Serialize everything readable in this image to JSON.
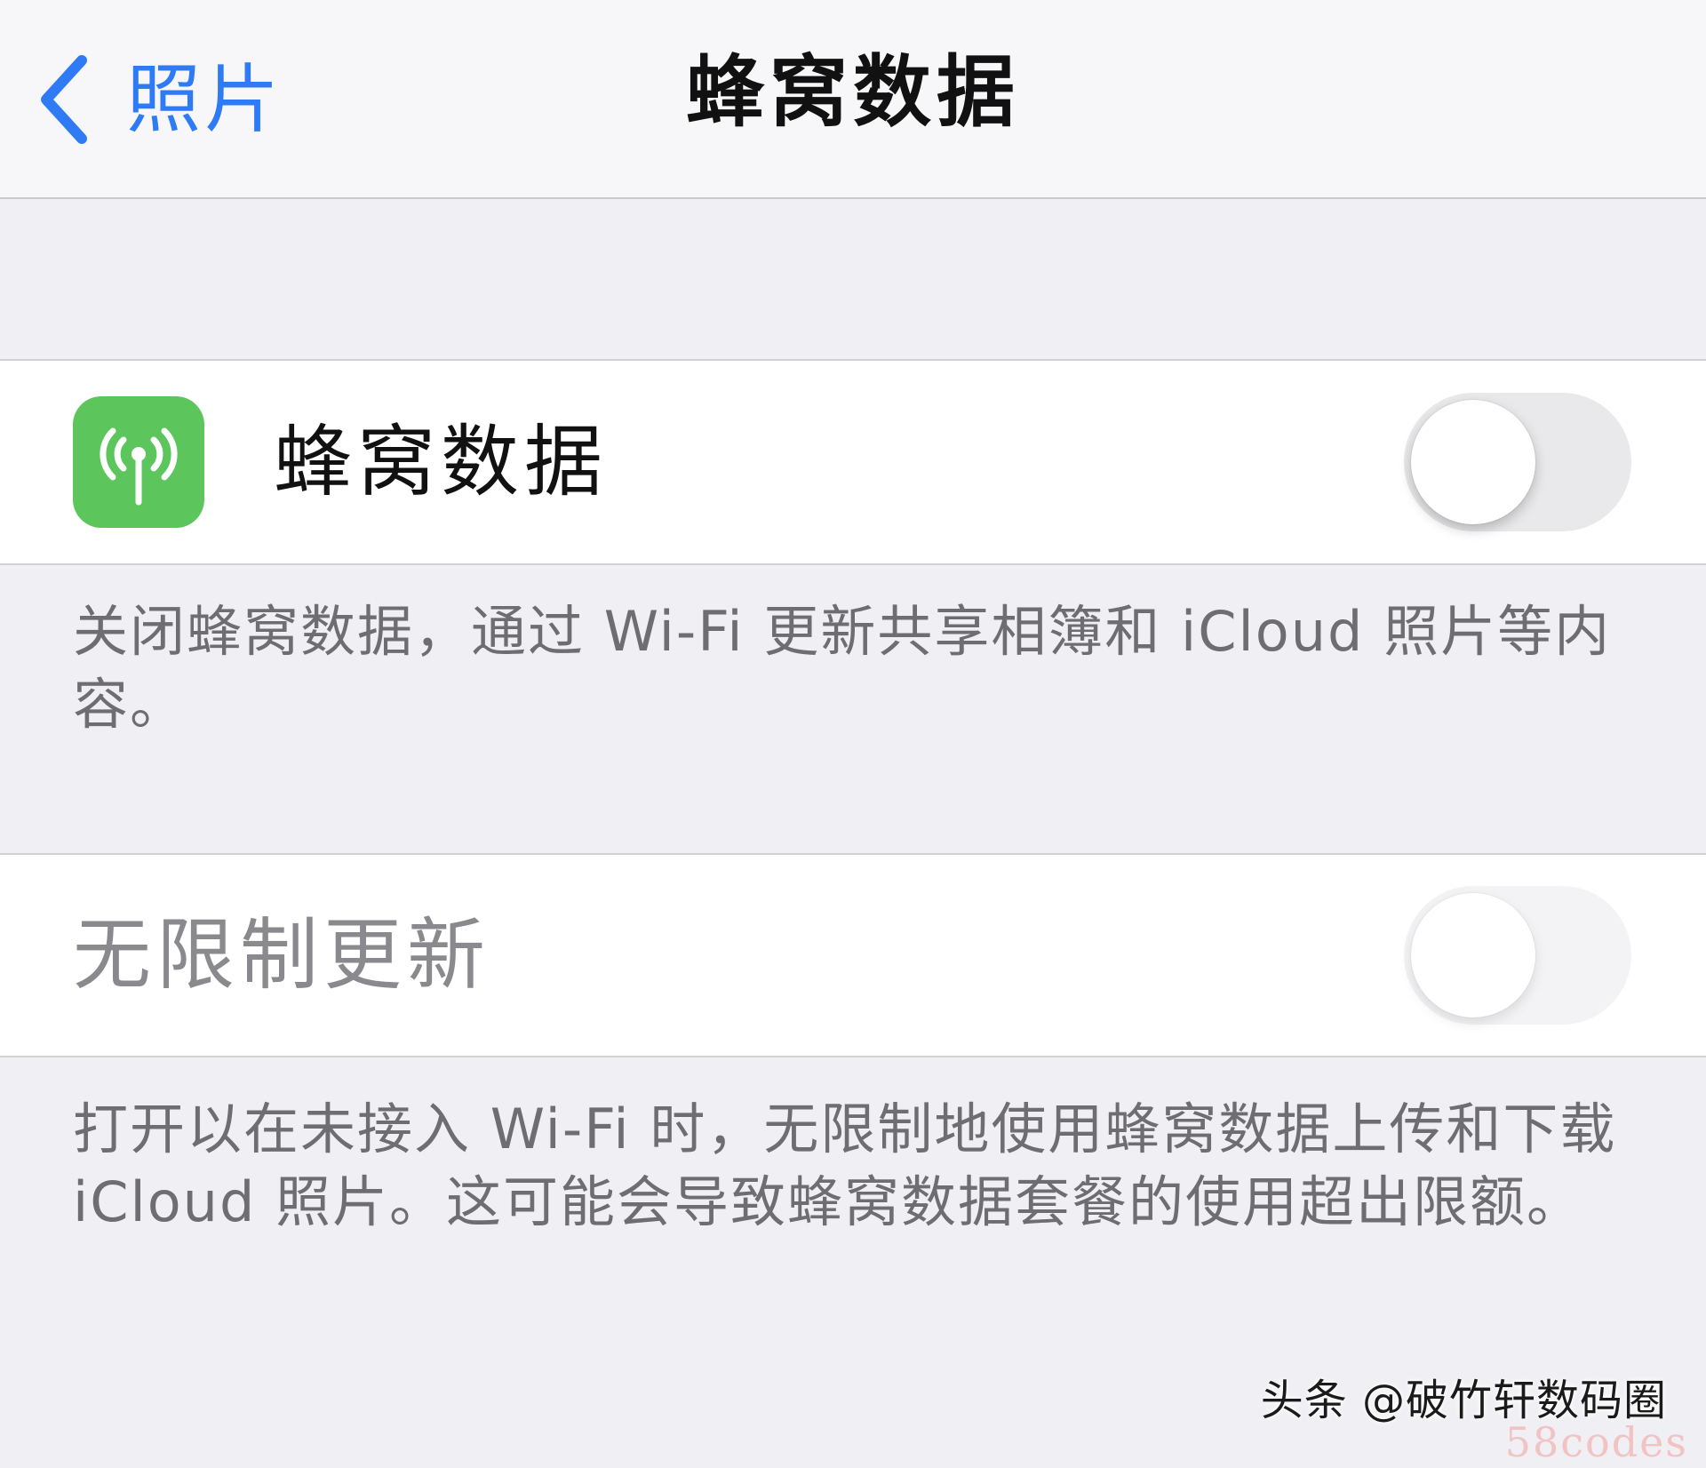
{
  "colors": {
    "accent": "#2f7bf5",
    "app_icon_green": "#5cc65c",
    "background": "#efeff4"
  },
  "nav": {
    "back_label": "照片",
    "back_icon": "chevron-left-icon",
    "title": "蜂窝数据"
  },
  "cellular": {
    "icon": "antenna-signal-icon",
    "label": "蜂窝数据",
    "enabled": false,
    "footer": "关闭蜂窝数据，通过 Wi-Fi 更新共享相簿和 iCloud 照片等内容。"
  },
  "unlimited": {
    "label": "无限制更新",
    "enabled": false,
    "disabled": true,
    "footer": "打开以在未接入 Wi-Fi 时，无限制地使用蜂窝数据上传和下载 iCloud 照片。这可能会导致蜂窝数据套餐的使用超出限额。"
  },
  "watermark": {
    "source": "头条 @破竹轩数码圈",
    "site": "58codes"
  }
}
